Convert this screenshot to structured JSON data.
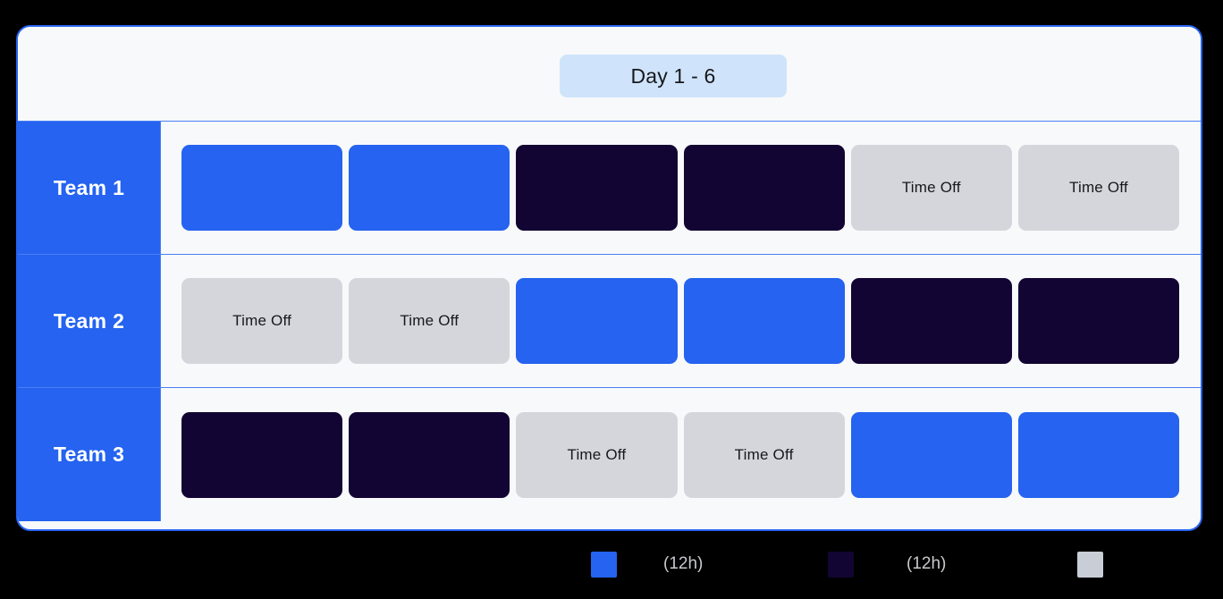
{
  "header": {
    "day_range_label": "Day 1 - 6"
  },
  "colors": {
    "accent_blue": "#2563F0",
    "day_shift": "#2563F0",
    "night_shift": "#120533",
    "time_off": "#D5D6DB",
    "badge_bg": "#CFE4FB",
    "card_bg": "#F8F9FA",
    "page_bg": "#000000",
    "grid_line": "#4A7FF5"
  },
  "rows": [
    {
      "team_label": "Team 1",
      "cells": [
        {
          "type": "day",
          "label": ""
        },
        {
          "type": "day",
          "label": ""
        },
        {
          "type": "night",
          "label": ""
        },
        {
          "type": "night",
          "label": ""
        },
        {
          "type": "off",
          "label": "Time Off"
        },
        {
          "type": "off",
          "label": "Time Off"
        }
      ]
    },
    {
      "team_label": "Team 2",
      "cells": [
        {
          "type": "off",
          "label": "Time Off"
        },
        {
          "type": "off",
          "label": "Time Off"
        },
        {
          "type": "day",
          "label": ""
        },
        {
          "type": "day",
          "label": ""
        },
        {
          "type": "night",
          "label": ""
        },
        {
          "type": "night",
          "label": ""
        }
      ]
    },
    {
      "team_label": "Team 3",
      "cells": [
        {
          "type": "night",
          "label": ""
        },
        {
          "type": "night",
          "label": ""
        },
        {
          "type": "off",
          "label": "Time Off"
        },
        {
          "type": "off",
          "label": "Time Off"
        },
        {
          "type": "day",
          "label": ""
        },
        {
          "type": "day",
          "label": ""
        }
      ]
    }
  ],
  "legend": [
    {
      "swatch_color": "#2563F0",
      "label": "(12h)"
    },
    {
      "swatch_color": "#120533",
      "label": "(12h)"
    },
    {
      "swatch_color": "#C9CDD6",
      "label": ""
    }
  ]
}
